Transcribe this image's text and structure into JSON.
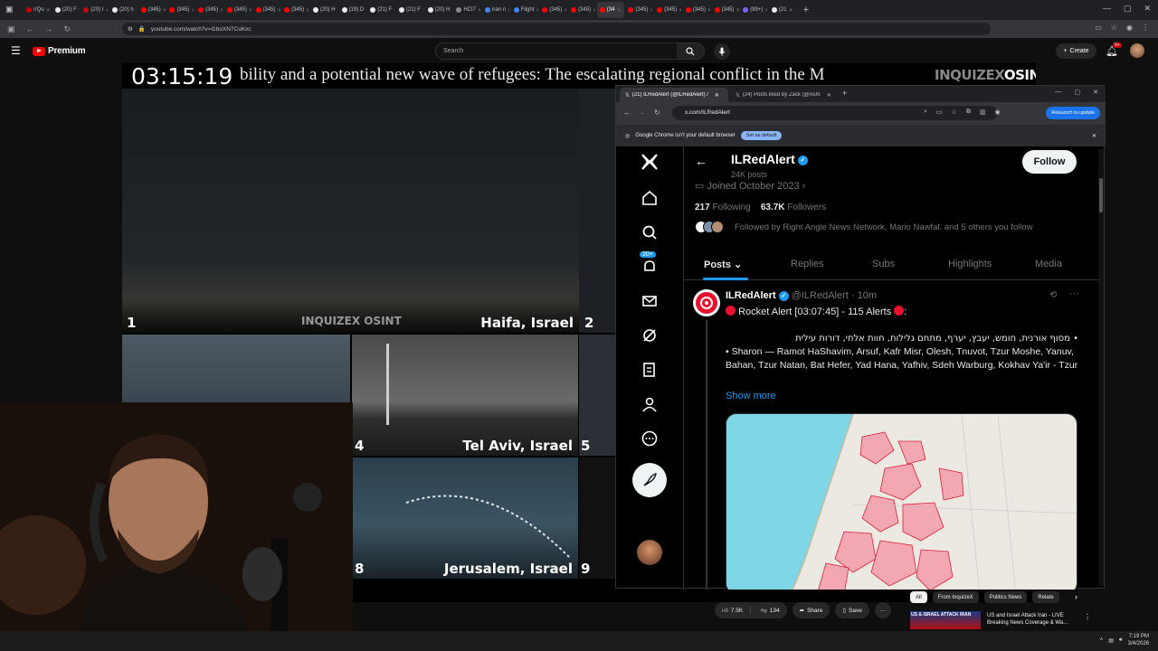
{
  "browser": {
    "tabs": [
      "r/Qu",
      "(20) F",
      "(20) I",
      "(20) h",
      "(345)",
      "(345)",
      "(345)",
      "(345)",
      "(345)",
      "(345)",
      "(20) H",
      "(19) D",
      "(21) F",
      "(21) F",
      "(20) H",
      "HCI7",
      "iran n",
      "Flight",
      "(345)",
      "(345)",
      "(34",
      "(345)",
      "(345)",
      "(345)",
      "(345)",
      "(99+)",
      "(21"
    ],
    "active_tab_index": 20,
    "url": "youtube.com/watch?v=l1boXN7CuKxc"
  },
  "youtube": {
    "logo_text": "Premium",
    "search_placeholder": "Search",
    "create_label": "Create",
    "notification_count": "9+"
  },
  "video": {
    "clock": "03:15:19",
    "headline": "bility and a potential new wave of refugees: The escalating regional conflict in the M",
    "logo_a": "INQUIZEX",
    "logo_b": "OSINT",
    "cameras": [
      {
        "num": "1",
        "label": ""
      },
      {
        "num": "2",
        "label": "Haifa, Israel"
      },
      {
        "num": "4",
        "label": ""
      },
      {
        "num": "5",
        "label": "Tel Aviv, Israel"
      },
      {
        "num": "8",
        "label": ""
      },
      {
        "num": "9",
        "label": "Jerusalem, Israel"
      }
    ]
  },
  "inner_browser": {
    "tab1": "(21) ILRedAlert (@ILRedAlert) /",
    "tab2": "(24) Posts liked by Zack (@Asm",
    "url": "x.com/ILRedAlert",
    "relaunch": "Relaunch to update",
    "info_text": "Google Chrome isn't your default browser",
    "set_default": "Set as default"
  },
  "x": {
    "notification_badge": "20+",
    "profile": {
      "name": "ILRedAlert",
      "posts_count": "24K posts",
      "joined": "Joined October 2023",
      "following_count": "217",
      "following_label": "Following",
      "followers_count": "63.7K",
      "followers_label": "Followers",
      "followed_by": "Followed by Right Angle News Network, Mario Nawfal, and 5 others you follow",
      "follow_label": "Follow"
    },
    "tabs": [
      "Posts",
      "Replies",
      "Subs",
      "Highlights",
      "Media"
    ],
    "tweet": {
      "name": "ILRedAlert",
      "handle": "@ILRedAlert · 10m",
      "headline": "Rocket Alert [03:07:45] - 115 Alerts",
      "line_hebrew": "• מסוף אורנית, חומש, יעבץ, יערף, מתחם גלילות, חוות אלחי, דורות עילית",
      "line_sharon": "• Sharon — Ramot HaShavim, Arsuf, Kafr Misr, Olesh, Tnuvot, Tzur Moshe, Yanuv, Bahan, Tzur Natan, Bat Hefer, Yad Hana, Yafhiv, Sdeh Warburg, Kokhav Ya'ir - Tzur",
      "show_more": "Show more"
    }
  },
  "bottom": {
    "likes": "7.5K",
    "dislikes": "134",
    "share": "Share",
    "save": "Save",
    "chips": [
      "All",
      "From InquizeX",
      "Politics News",
      "Relate"
    ],
    "rec_banner": "US & ISRAEL ATTACK IRAN",
    "rec_title": "US and Israel Attack Iran - LIVE Breaking News Coverage & Wa...",
    "time": "7:19 PM",
    "date": "3/4/2026"
  },
  "colors": {
    "x_blue": "#1d9bf0",
    "yt_red": "#ff0000",
    "alert_red": "#e8112d"
  }
}
